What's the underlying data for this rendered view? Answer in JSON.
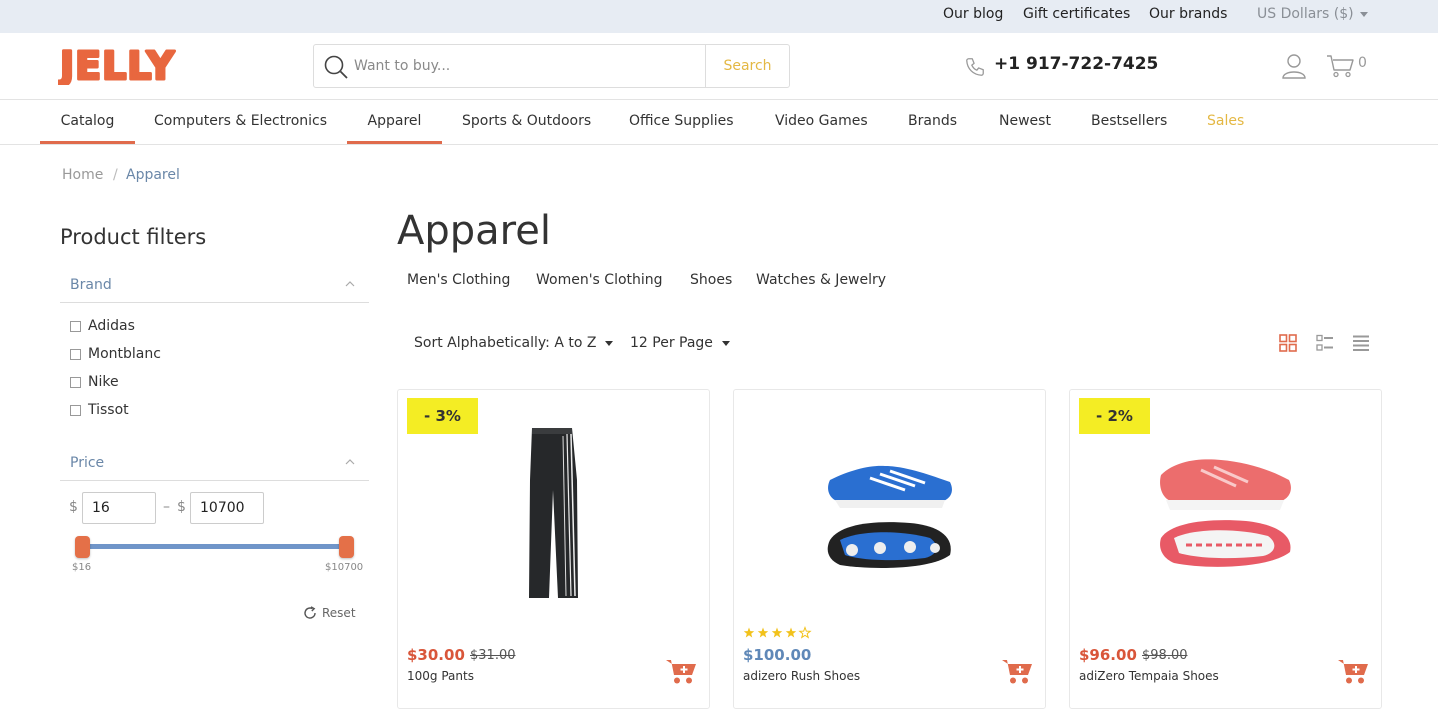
{
  "topbar": {
    "links": [
      "Our blog",
      "Gift certificates",
      "Our brands"
    ],
    "currency": "US Dollars ($)"
  },
  "header": {
    "logo_text": "JELLY",
    "search": {
      "placeholder": "Want to buy...",
      "button": "Search"
    },
    "phone": "+1 917-722-7425",
    "cart_count": "0"
  },
  "nav": {
    "items": [
      "Catalog",
      "Computers & Electronics",
      "Apparel",
      "Sports & Outdoors",
      "Office Supplies",
      "Video Games",
      "Brands",
      "Newest",
      "Bestsellers",
      "Sales"
    ],
    "active": [
      "Catalog",
      "Apparel"
    ]
  },
  "breadcrumb": {
    "home": "Home",
    "separator": "/",
    "current": "Apparel"
  },
  "filters": {
    "title": "Product filters",
    "brand_label": "Brand",
    "brands": [
      "Adidas",
      "Montblanc",
      "Nike",
      "Tissot"
    ],
    "price_label": "Price",
    "currency_symbol": "$",
    "dash": "–",
    "min": "16",
    "max": "10700",
    "range_min_label": "$16",
    "range_max_label": "$10700",
    "reset": "Reset"
  },
  "main": {
    "title": "Apparel",
    "subcategories": [
      "Men's Clothing",
      "Women's Clothing",
      "Shoes",
      "Watches & Jewelry"
    ],
    "sort": "Sort Alphabetically: A to Z",
    "per_page": "12 Per Page"
  },
  "products": [
    {
      "badge": "- 3%",
      "price": "$30.00",
      "old_price": "$31.00",
      "name": "100g Pants",
      "rating": 0
    },
    {
      "badge": "",
      "price": "$100.00",
      "old_price": "",
      "name": "adizero Rush Shoes",
      "rating": 4
    },
    {
      "badge": "- 2%",
      "price": "$96.00",
      "old_price": "$98.00",
      "name": "adiZero Tempaia Shoes",
      "rating": 0
    }
  ],
  "colors": {
    "accent": "#e06b4c",
    "search_button": "#e4b844",
    "sale_price": "#d9563a",
    "regular_price": "#5f88b8",
    "badge": "#f4ed24",
    "link": "#6a87a8",
    "sales_nav": "#e4b844"
  }
}
